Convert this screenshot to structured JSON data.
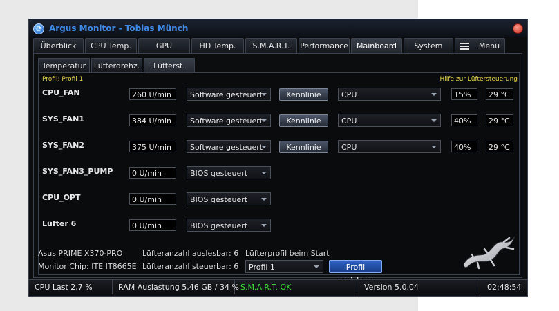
{
  "window": {
    "title": "Argus Monitor - Tobias Münch"
  },
  "tabs": [
    {
      "label": "Überblick"
    },
    {
      "label": "CPU Temp."
    },
    {
      "label": "GPU"
    },
    {
      "label": "HD Temp."
    },
    {
      "label": "S.M.A.R.T."
    },
    {
      "label": "Performance"
    },
    {
      "label": "Mainboard"
    },
    {
      "label": "System"
    },
    {
      "label": "Menü",
      "icon": "hamburger-menu-icon"
    }
  ],
  "active_tab": "Mainboard",
  "subtabs": [
    {
      "label": "Temperatur"
    },
    {
      "label": "Lüfterdrehz."
    },
    {
      "label": "Lüfterst."
    }
  ],
  "active_subtab": "Lüfterst.",
  "profil_label": "Profil: Profil 1",
  "hilfe_label": "Hilfe zur Lüftersteuerung",
  "fans": [
    {
      "name": "CPU_FAN",
      "rpm": "260 U/min",
      "mode": "Software gesteuert",
      "curve_button": "Kennlinie",
      "source": "CPU",
      "percent": "15%",
      "temp": "29 °C"
    },
    {
      "name": "SYS_FAN1",
      "rpm": "384 U/min",
      "mode": "Software gesteuert",
      "curve_button": "Kennlinie",
      "source": "CPU",
      "percent": "40%",
      "temp": "29 °C"
    },
    {
      "name": "SYS_FAN2",
      "rpm": "375 U/min",
      "mode": "Software gesteuert",
      "curve_button": "Kennlinie",
      "source": "CPU",
      "percent": "40%",
      "temp": "29 °C"
    },
    {
      "name": "SYS_FAN3_PUMP",
      "rpm": "0 U/min",
      "mode": "BIOS gesteuert"
    },
    {
      "name": "CPU_OPT",
      "rpm": "0 U/min",
      "mode": "BIOS gesteuert"
    },
    {
      "name": "Lüfter 6",
      "rpm": "0 U/min",
      "mode": "BIOS gesteuert"
    }
  ],
  "board_info": {
    "board": "Asus PRIME X370-PRO",
    "chip": "Monitor Chip: ITE IT8665E",
    "readable": "Lüfteranzahl auslesbar: 6",
    "controllable": "Lüfteranzahl steuerbar: 6",
    "startup_profile_label": "Lüfterprofil beim Start",
    "startup_profile_value": "Profil 1",
    "save_button": "Profil speichern"
  },
  "status": {
    "cpu_load": "CPU Last 2,7 %",
    "ram": "RAM Auslastung 5,46 GB / 34 %",
    "smart": "S.M.A.R.T. OK",
    "version": "Version 5.0.04",
    "time": "02:48:54"
  },
  "colors": {
    "title_blue": "#3f8ae6",
    "smart_ok_green": "#3fe03a",
    "hint_yellow": "#e8d44a",
    "button_blue": "#2f63c6"
  }
}
